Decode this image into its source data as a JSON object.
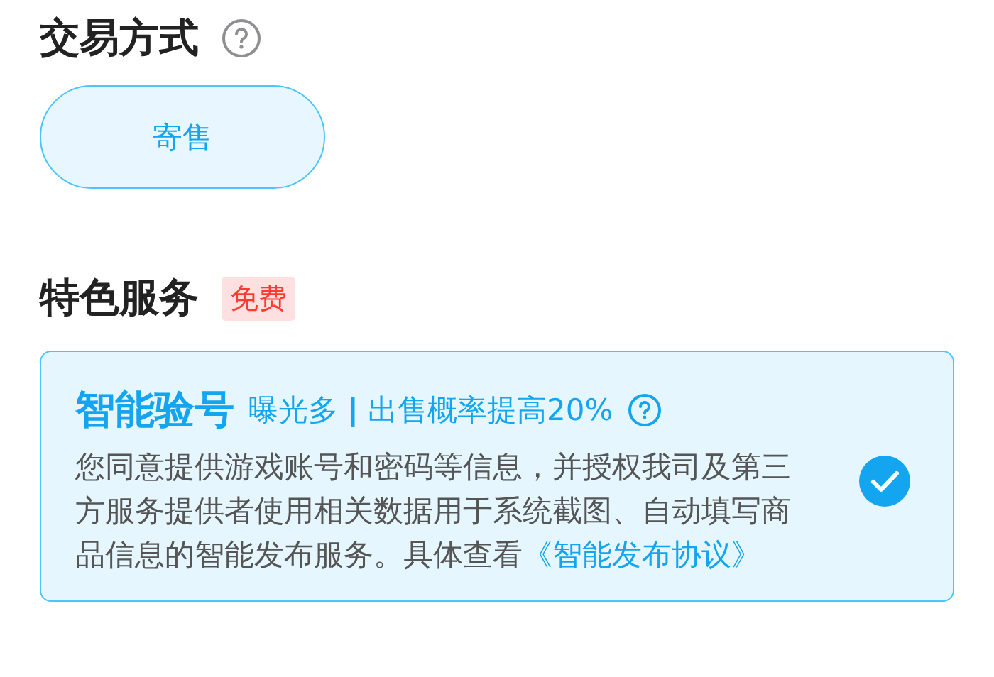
{
  "trade_method": {
    "title": "交易方式",
    "options": [
      {
        "label": "寄售",
        "selected": true
      }
    ]
  },
  "special_services": {
    "title": "特色服务",
    "badge": "免费",
    "items": [
      {
        "title": "智能验号",
        "tagline": "曝光多 **|** 出售概率提高20%",
        "description": "您同意提供游戏账号和密码等信息，并授权我司及第三方服务提供者使用相关数据用于系统截图、自动填写商品信息的智能发布服务。具体查看",
        "link": "《智能发布协议》",
        "checked": true
      }
    ]
  }
}
